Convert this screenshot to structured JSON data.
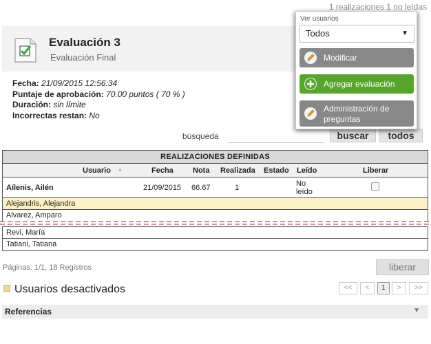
{
  "top_status": "1 realizaciones 1 no leídas",
  "header": {
    "title": "Evaluación 3",
    "subtitle": "Evaluación Final"
  },
  "info": {
    "fecha_label": "Fecha:",
    "fecha_value": "21/09/2015 12:56:34",
    "puntaje_label": "Puntaje de aprobación:",
    "puntaje_value": "70.00 puntos ( 70 % )",
    "duracion_label": "Duración:",
    "duracion_value": "sin límite",
    "incorrectas_label": "Incorrectas restan:",
    "incorrectas_value": "No"
  },
  "search": {
    "label": "búsqueda",
    "value": "",
    "buscar": "buscar",
    "todos": "todos"
  },
  "table": {
    "title": "REALIZACIONES DEFINIDAS",
    "headers": {
      "usuario": "Usuario",
      "fecha": "Fecha",
      "nota": "Nota",
      "realizada": "Realizada",
      "estado": "Estado",
      "leido": "Leído",
      "liberar": "Liberar"
    },
    "main_row": {
      "usuario": "Aílenis, Ailén",
      "fecha": "21/09/2015",
      "nota": "66.67",
      "realizada": "1",
      "estado": "",
      "leido_1": "No",
      "leido_2": "leído",
      "liberar_checked": false
    },
    "rows_top": [
      "Alejandris, Alejandra",
      "Alvarez, Amparo"
    ],
    "rows_bottom": [
      "Revi, María",
      "Tatiani, Tatiana"
    ]
  },
  "pagination": {
    "summary": "Páginas: 1/1, 18 Registros",
    "liberar": "liberar",
    "first": "<<",
    "prev": "<",
    "current": "1",
    "next": ">",
    "last": ">>"
  },
  "deactivated": "Usuarios desactivados",
  "references": "Referencias",
  "panel": {
    "label": "Ver usuarios",
    "select_value": "Todos",
    "buttons": [
      "Modificar",
      "Agregar evaluación",
      "Administración de",
      "preguntas"
    ]
  },
  "colors": {
    "green": "#57a52c",
    "grey_button": "#888888",
    "highlight_row": "#fdf0c2"
  }
}
